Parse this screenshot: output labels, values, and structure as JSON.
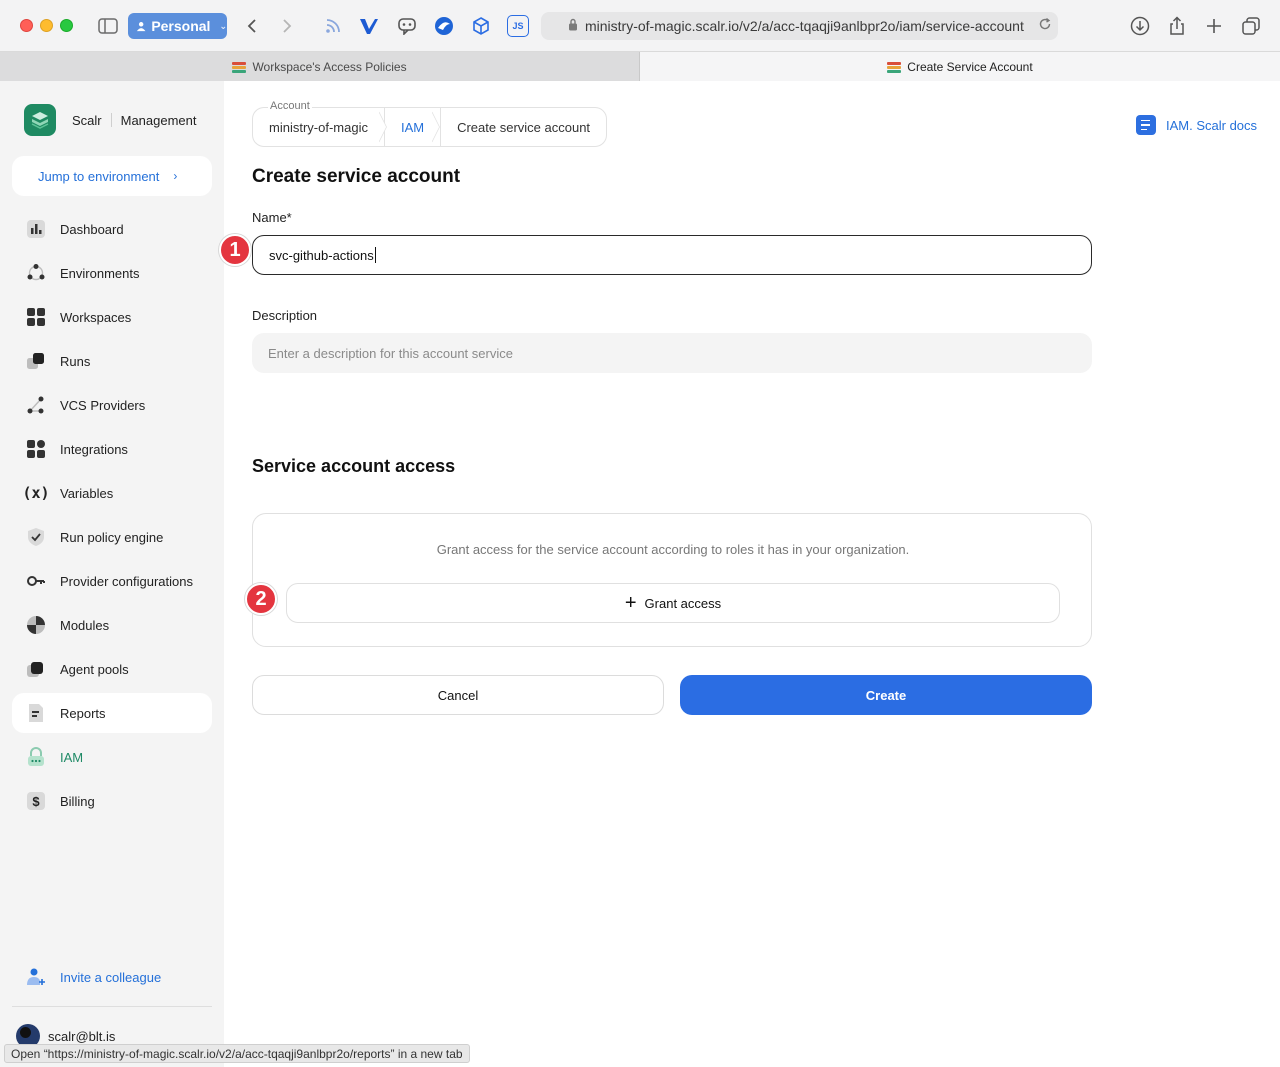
{
  "browser": {
    "profile": "Personal",
    "url": "ministry-of-magic.scalr.io/v2/a/acc-tqaqji9anlbpr2o/iam/service-account",
    "tabs": [
      {
        "title": "Workspace's Access Policies"
      },
      {
        "title": "Create Service Account"
      }
    ],
    "extensions": [
      "rss-icon",
      "v-extension-icon",
      "chat-extension-icon",
      "browser-extension-icon",
      "cube-extension-icon",
      "JS"
    ],
    "status_url": "Open “https://ministry-of-magic.scalr.io/v2/a/acc-tqaqji9anlbpr2o/reports” in a new tab"
  },
  "sidebar": {
    "brand": "Scalr",
    "section": "Management",
    "jump": "Jump to environment",
    "items": [
      {
        "label": "Dashboard",
        "icon": "dashboard-icon"
      },
      {
        "label": "Environments",
        "icon": "environments-icon"
      },
      {
        "label": "Workspaces",
        "icon": "workspaces-icon"
      },
      {
        "label": "Runs",
        "icon": "runs-icon"
      },
      {
        "label": "VCS Providers",
        "icon": "vcs-icon"
      },
      {
        "label": "Integrations",
        "icon": "integrations-icon"
      },
      {
        "label": "Variables",
        "icon": "variables-icon"
      },
      {
        "label": "Run policy engine",
        "icon": "shield-check-icon"
      },
      {
        "label": "Provider configurations",
        "icon": "key-icon"
      },
      {
        "label": "Modules",
        "icon": "modules-icon"
      },
      {
        "label": "Agent pools",
        "icon": "agent-pools-icon"
      },
      {
        "label": "Reports",
        "icon": "reports-icon"
      },
      {
        "label": "IAM",
        "icon": "lock-icon"
      },
      {
        "label": "Billing",
        "icon": "dollar-icon"
      }
    ],
    "invite": "Invite a colleague",
    "user": "scalr@blt.is"
  },
  "breadcrumb": {
    "account_label": "Account",
    "account": "ministry-of-magic",
    "iam": "IAM",
    "current": "Create service account"
  },
  "docs_link": "IAM. Scalr docs",
  "form": {
    "title": "Create service account",
    "name_label": "Name*",
    "name_value": "svc-github-actions",
    "description_label": "Description",
    "description_placeholder": "Enter a description for this account service",
    "access_title": "Service account access",
    "access_text": "Grant access for the service account according to roles it has in your organization.",
    "grant_label": "Grant access",
    "cancel_label": "Cancel",
    "create_label": "Create"
  },
  "annotations": {
    "step1": "1",
    "step2": "2"
  },
  "colors": {
    "accent": "#2b6de3",
    "brand": "#1e8a62",
    "marker": "#e4353f"
  }
}
